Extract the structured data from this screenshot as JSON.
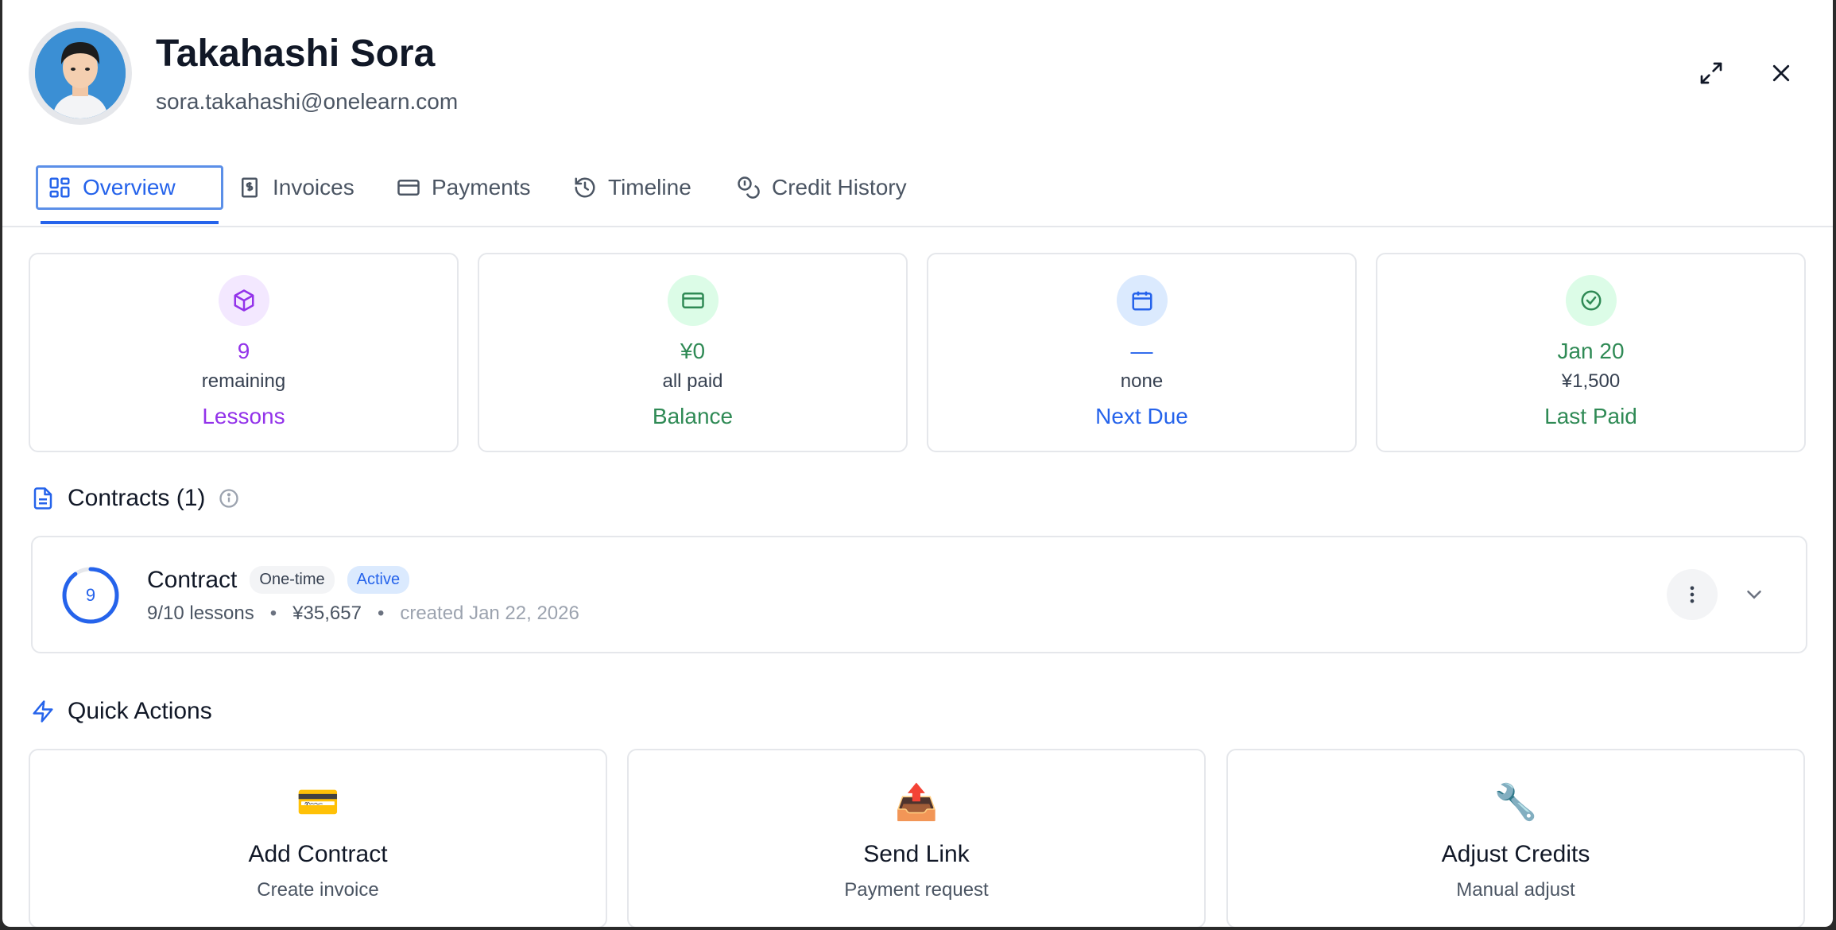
{
  "student": {
    "name": "Takahashi Sora",
    "email": "sora.takahashi@onelearn.com"
  },
  "tabs": [
    {
      "label": "Overview",
      "icon": "dashboard-icon",
      "active": true
    },
    {
      "label": "Invoices",
      "icon": "receipt-icon"
    },
    {
      "label": "Payments",
      "icon": "credit-card-icon"
    },
    {
      "label": "Timeline",
      "icon": "history-icon"
    },
    {
      "label": "Credit History",
      "icon": "coins-icon"
    }
  ],
  "stats": [
    {
      "value": "9",
      "sub": "remaining",
      "label": "Lessons",
      "icon": "package-icon",
      "color": "#9333ea",
      "bg": "#f3e8ff"
    },
    {
      "value": "¥0",
      "sub": "all paid",
      "label": "Balance",
      "icon": "credit-card-icon",
      "color": "#2f8a55",
      "bg": "#dcfce7"
    },
    {
      "value": "—",
      "sub": "none",
      "label": "Next Due",
      "icon": "calendar-icon",
      "color": "#2563eb",
      "bg": "#dbeafe"
    },
    {
      "value": "Jan 20",
      "sub": "¥1,500",
      "label": "Last Paid",
      "icon": "check-circle-icon",
      "color": "#2f8a55",
      "bg": "#dcfce7"
    }
  ],
  "contracts": {
    "title": "Contracts (1)",
    "items": [
      {
        "name": "Contract",
        "type_badge": "One-time",
        "status_badge": "Active",
        "remaining": "9",
        "lessons_used": 9,
        "lessons_total": 10,
        "lessons": "9/10 lessons",
        "amount": "¥35,657",
        "created": "created Jan 22, 2026"
      }
    ]
  },
  "quick_actions": {
    "title": "Quick Actions",
    "items": [
      {
        "emoji": "💳",
        "title": "Add Contract",
        "sub": "Create invoice"
      },
      {
        "emoji": "📤",
        "title": "Send Link",
        "sub": "Payment request"
      },
      {
        "emoji": "🔧",
        "title": "Adjust Credits",
        "sub": "Manual adjust"
      }
    ]
  },
  "colors": {
    "accent": "#2563eb",
    "purple": "#9333ea",
    "green": "#2f8a55"
  }
}
